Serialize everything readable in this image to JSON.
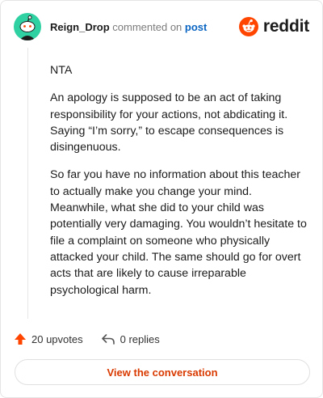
{
  "header": {
    "author": "Reign_Drop",
    "action_text": "commented on",
    "post_link": "post",
    "brand": "reddit"
  },
  "comment": {
    "paragraphs": [
      "NTA",
      "An apology is supposed to be an act of taking responsibility for your actions, not abdicating it. Saying “I’m sorry,” to escape consequences is disingenuous.",
      "So far you have no information about this teacher to actually make you change your mind. Meanwhile, what she did to your child was potentially very damaging. You wouldn’t hesitate to file a complaint on someone who physically attacked your child. The same should go for overt acts that are likely to cause irreparable psychological harm."
    ]
  },
  "actions": {
    "upvotes": "20 upvotes",
    "replies": "0 replies"
  },
  "cta": {
    "label": "View the conversation"
  },
  "icons": {
    "avatar": "snoo-avatar-icon",
    "brand_logo": "reddit-logo-icon",
    "upvote": "upvote-arrow-icon",
    "reply": "reply-arrow-icon"
  },
  "colors": {
    "brand_orange": "#ff4500",
    "avatar_bg": "#2fd1a3",
    "link_blue": "#0a65c2",
    "cta_text": "#d93a00"
  }
}
